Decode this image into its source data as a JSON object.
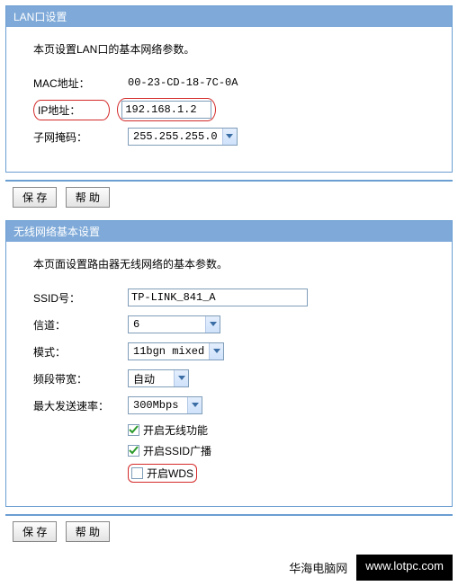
{
  "lan": {
    "title": "LAN口设置",
    "desc": "本页设置LAN口的基本网络参数。",
    "mac_label": "MAC地址：",
    "mac_value": "00-23-CD-18-7C-0A",
    "ip_label": "IP地址：",
    "ip_value": "192.168.1.2",
    "mask_label": "子网掩码：",
    "mask_value": "255.255.255.0"
  },
  "wlan": {
    "title": "无线网络基本设置",
    "desc": "本页面设置路由器无线网络的基本参数。",
    "ssid_label": "SSID号：",
    "ssid_value": "TP-LINK_841_A",
    "channel_label": "信道：",
    "channel_value": "6",
    "mode_label": "模式：",
    "mode_value": "11bgn mixed",
    "bandwidth_label": "频段带宽：",
    "bandwidth_value": "自动",
    "rate_label": "最大发送速率：",
    "rate_value": "300Mbps",
    "chk_enable_wireless": "开启无线功能",
    "chk_enable_ssid": "开启SSID广播",
    "chk_enable_wds": "开启WDS"
  },
  "buttons": {
    "save": "保 存",
    "help": "帮 助"
  },
  "watermark": {
    "left": "华海电脑网",
    "right": "www.lotpc.com"
  }
}
